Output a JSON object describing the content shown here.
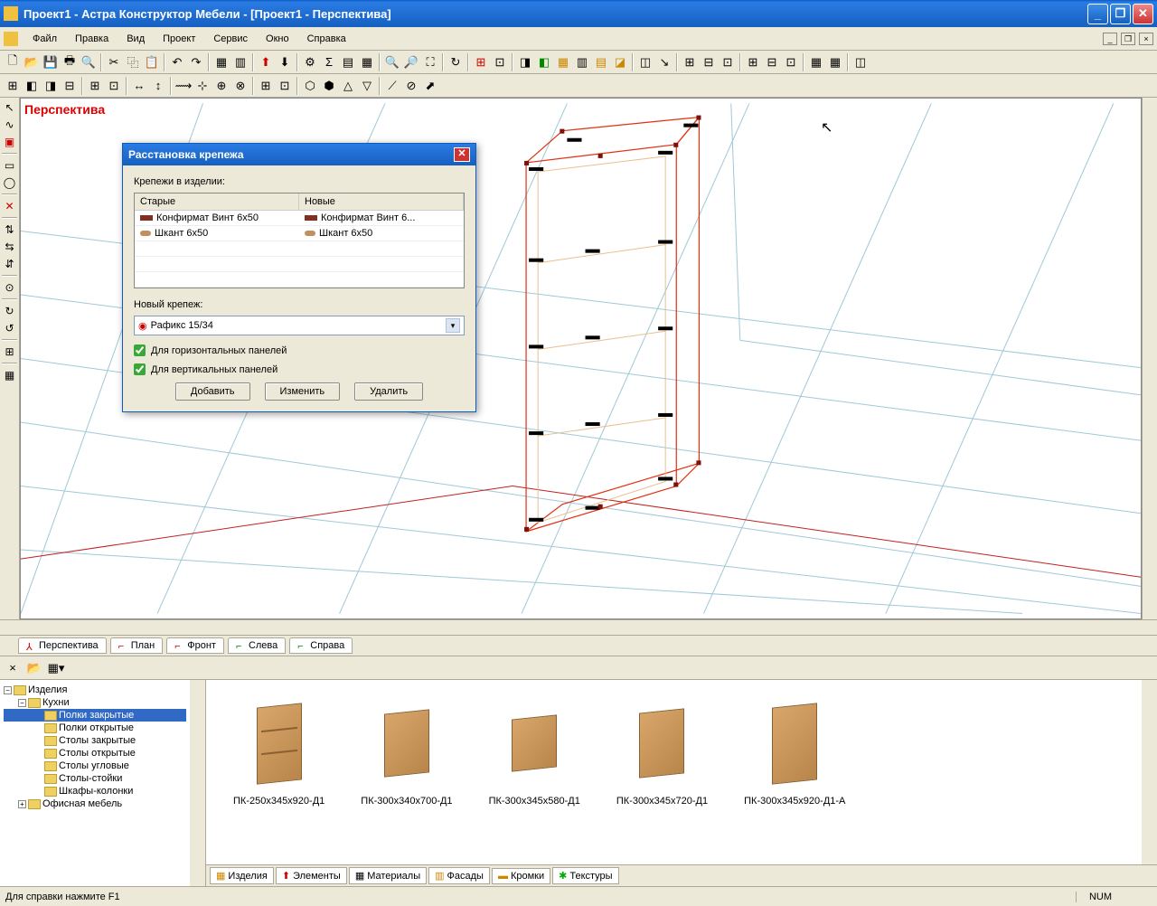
{
  "title": "Проект1 - Астра Конструктор Мебели - [Проект1 - Перспектива]",
  "menu": {
    "items": [
      "Файл",
      "Правка",
      "Вид",
      "Проект",
      "Сервис",
      "Окно",
      "Справка"
    ]
  },
  "viewport_label": "Перспектива",
  "view_tabs": [
    "Перспектива",
    "План",
    "Фронт",
    "Слева",
    "Справа"
  ],
  "dialog": {
    "title": "Расстановка крепежа",
    "list_label": "Крепежи в изделии:",
    "col_old": "Старые",
    "col_new": "Новые",
    "rows": [
      {
        "old": "Конфирмат Винт 6x50",
        "new": "Конфирмат Винт 6..."
      },
      {
        "old": "Шкант 6x50",
        "new": "Шкант 6x50"
      }
    ],
    "new_label": "Новый крепеж:",
    "combo_value": "Рафикс 15/34",
    "check_h": "Для горизонтальных панелей",
    "check_v": "Для вертикальных панелей",
    "btn_add": "Добавить",
    "btn_edit": "Изменить",
    "btn_del": "Удалить"
  },
  "tree": {
    "root": "Изделия",
    "kitchen": "Кухни",
    "items": [
      "Полки закрытые",
      "Полки открытые",
      "Столы закрытые",
      "Столы открытые",
      "Столы угловые",
      "Столы-стойки",
      "Шкафы-колонки"
    ],
    "selected_index": 0,
    "office": "Офисная мебель"
  },
  "catalog": {
    "items": [
      "ПК-250x345x920-Д1",
      "ПК-300x340x700-Д1",
      "ПК-300x345x580-Д1",
      "ПК-300x345x720-Д1",
      "ПК-300x345x920-Д1-А"
    ],
    "tabs": [
      "Изделия",
      "Элементы",
      "Материалы",
      "Фасады",
      "Кромки",
      "Текстуры"
    ]
  },
  "status": {
    "help": "Для справки нажмите F1",
    "num": "NUM"
  }
}
